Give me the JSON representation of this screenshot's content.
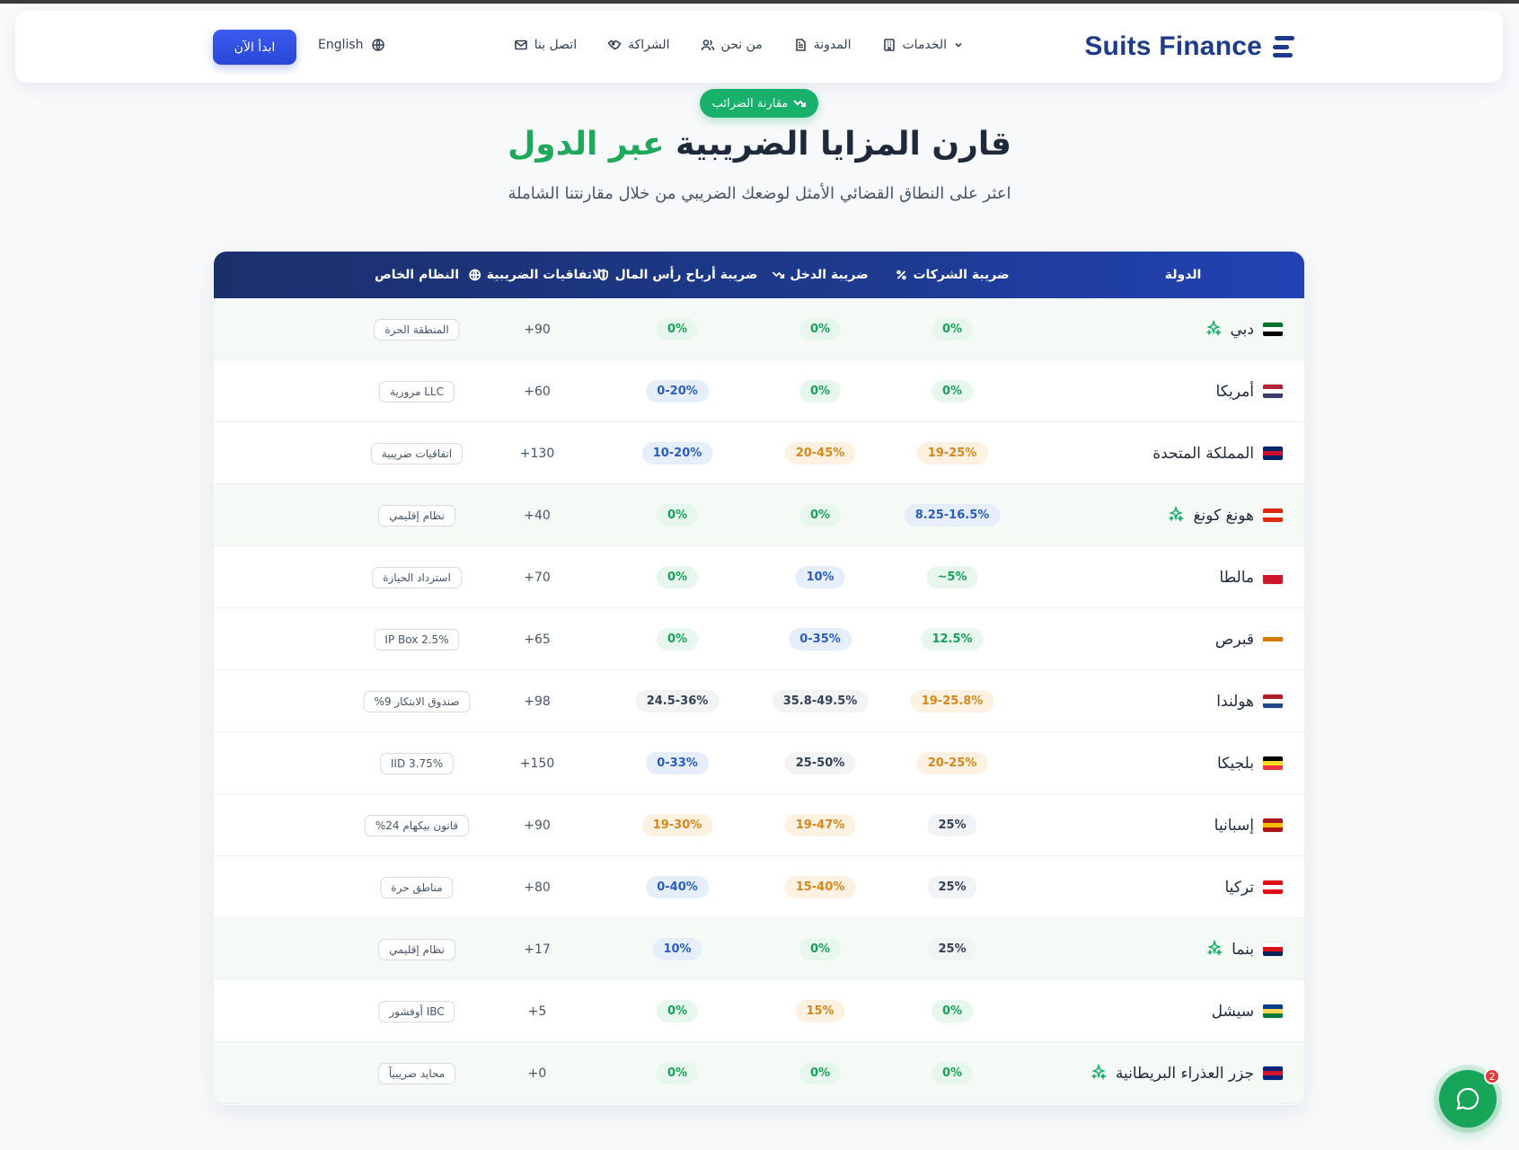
{
  "header": {
    "brand": "Suits Finance",
    "nav": [
      {
        "label": "الخدمات",
        "icon": "building-icon",
        "has_dropdown": true
      },
      {
        "label": "المدونة",
        "icon": "document-icon",
        "has_dropdown": false
      },
      {
        "label": "من نحن",
        "icon": "users-icon",
        "has_dropdown": false
      },
      {
        "label": "الشراكة",
        "icon": "handshake-icon",
        "has_dropdown": false
      },
      {
        "label": "اتصل بنا",
        "icon": "mail-icon",
        "has_dropdown": false
      }
    ],
    "language": "English",
    "cta": "ابدأ الآن"
  },
  "hero": {
    "pill": "مقارنة الضرائب",
    "title_main": "قارن المزايا الضريبية ",
    "title_accent": "عبر الدول",
    "subtitle": "اعثر على النطاق القضائي الأمثل لوضعك الضريبي من خلال مقارنتنا الشاملة"
  },
  "table": {
    "columns": [
      {
        "label": "الدولة",
        "icon": ""
      },
      {
        "label": "ضريبة الشركات",
        "icon": "percent-icon"
      },
      {
        "label": "ضريبة الدخل",
        "icon": "trend-down-icon"
      },
      {
        "label": "ضريبة أرباح رأس المال",
        "icon": "shield-icon"
      },
      {
        "label": "الاتفاقيات الضريبية",
        "icon": "globe-icon"
      },
      {
        "label": "النظام الخاص",
        "icon": ""
      }
    ],
    "rows": [
      {
        "country": "دبي",
        "featured": true,
        "corp": "0%",
        "corp_tone": "green",
        "income": "0%",
        "income_tone": "green",
        "cgt": "0%",
        "cgt_tone": "green",
        "treaties": "+90",
        "regime": "المنطقة الحرة"
      },
      {
        "country": "أمريكا",
        "featured": false,
        "corp": "0%",
        "corp_tone": "green",
        "income": "0%",
        "income_tone": "green",
        "cgt": "0-20%",
        "cgt_tone": "blue",
        "treaties": "+60",
        "regime": "LLC مرورية"
      },
      {
        "country": "المملكة المتحدة",
        "featured": false,
        "corp": "19-25%",
        "corp_tone": "orange",
        "income": "20-45%",
        "income_tone": "orange",
        "cgt": "10-20%",
        "cgt_tone": "blue",
        "treaties": "+130",
        "regime": "اتفاقيات ضريبية"
      },
      {
        "country": "هونغ كونغ",
        "featured": true,
        "corp": "8.25-16.5%",
        "corp_tone": "blue",
        "income": "0%",
        "income_tone": "green",
        "cgt": "0%",
        "cgt_tone": "green",
        "treaties": "+40",
        "regime": "نظام إقليمي"
      },
      {
        "country": "مالطا",
        "featured": false,
        "corp": "~5%",
        "corp_tone": "green",
        "income": "10%",
        "income_tone": "blue",
        "cgt": "0%",
        "cgt_tone": "green",
        "treaties": "+70",
        "regime": "استرداد الحيازة"
      },
      {
        "country": "قبرص",
        "featured": false,
        "corp": "12.5%",
        "corp_tone": "green",
        "income": "0-35%",
        "income_tone": "blue",
        "cgt": "0%",
        "cgt_tone": "green",
        "treaties": "+65",
        "regime": "IP Box 2.5%"
      },
      {
        "country": "هولندا",
        "featured": false,
        "corp": "19-25.8%",
        "corp_tone": "orange",
        "income": "35.8-49.5%",
        "income_tone": "gray",
        "cgt": "24.5-36%",
        "cgt_tone": "gray",
        "treaties": "+98",
        "regime": "صندوق الابتكار 9%"
      },
      {
        "country": "بلجيكا",
        "featured": false,
        "corp": "20-25%",
        "corp_tone": "orange",
        "income": "25-50%",
        "income_tone": "gray",
        "cgt": "0-33%",
        "cgt_tone": "blue",
        "treaties": "+150",
        "regime": "IID 3.75%"
      },
      {
        "country": "إسبانيا",
        "featured": false,
        "corp": "25%",
        "corp_tone": "gray",
        "income": "19-47%",
        "income_tone": "orange",
        "cgt": "19-30%",
        "cgt_tone": "orange",
        "treaties": "+90",
        "regime": "قانون بيكهام 24%"
      },
      {
        "country": "تركيا",
        "featured": false,
        "corp": "25%",
        "corp_tone": "gray",
        "income": "15-40%",
        "income_tone": "orange",
        "cgt": "0-40%",
        "cgt_tone": "blue",
        "treaties": "+80",
        "regime": "مناطق حرة"
      },
      {
        "country": "بنما",
        "featured": true,
        "corp": "25%",
        "corp_tone": "gray",
        "income": "0%",
        "income_tone": "green",
        "cgt": "10%",
        "cgt_tone": "blue",
        "treaties": "+17",
        "regime": "نظام إقليمي"
      },
      {
        "country": "سيشل",
        "featured": false,
        "corp": "0%",
        "corp_tone": "green",
        "income": "15%",
        "income_tone": "orange",
        "cgt": "0%",
        "cgt_tone": "green",
        "treaties": "+5",
        "regime": "IBC أوفشور"
      },
      {
        "country": "جزر العذراء البريطانية",
        "featured": true,
        "corp": "0%",
        "corp_tone": "green",
        "income": "0%",
        "income_tone": "green",
        "cgt": "0%",
        "cgt_tone": "green",
        "treaties": "+0",
        "regime": "محايد ضريبياً"
      }
    ]
  },
  "chat": {
    "badge": "2"
  },
  "colors": {
    "brand": "#1e3a8a",
    "accent_green": "#18b06a",
    "cta_blue": "#2f4fe0"
  }
}
